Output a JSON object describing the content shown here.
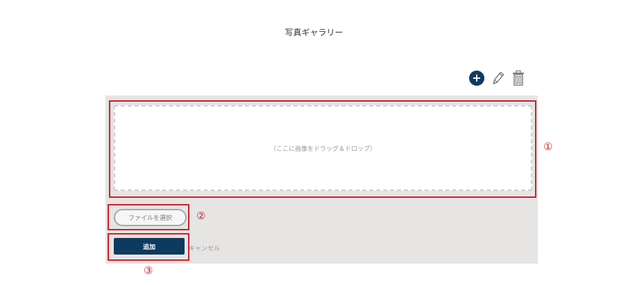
{
  "page": {
    "title": "写真ギャラリー"
  },
  "toolbar": {
    "add_icon": "plus-circle-icon",
    "add_glyph": "+",
    "edit_icon": "pencil-icon",
    "delete_icon": "trash-icon"
  },
  "upload": {
    "dropzone_text": "（ここに画像をドラッグ＆ドロップ）",
    "file_button_label": "ファイルを選択",
    "submit_label": "追加",
    "cancel_label": "キャンセル"
  },
  "annotations": {
    "marker_1": "①",
    "marker_2": "②",
    "marker_3": "③"
  },
  "colors": {
    "primary": "#0e3a5f",
    "annotation": "#cc1f2b",
    "panel_bg": "#e6e5e4"
  }
}
